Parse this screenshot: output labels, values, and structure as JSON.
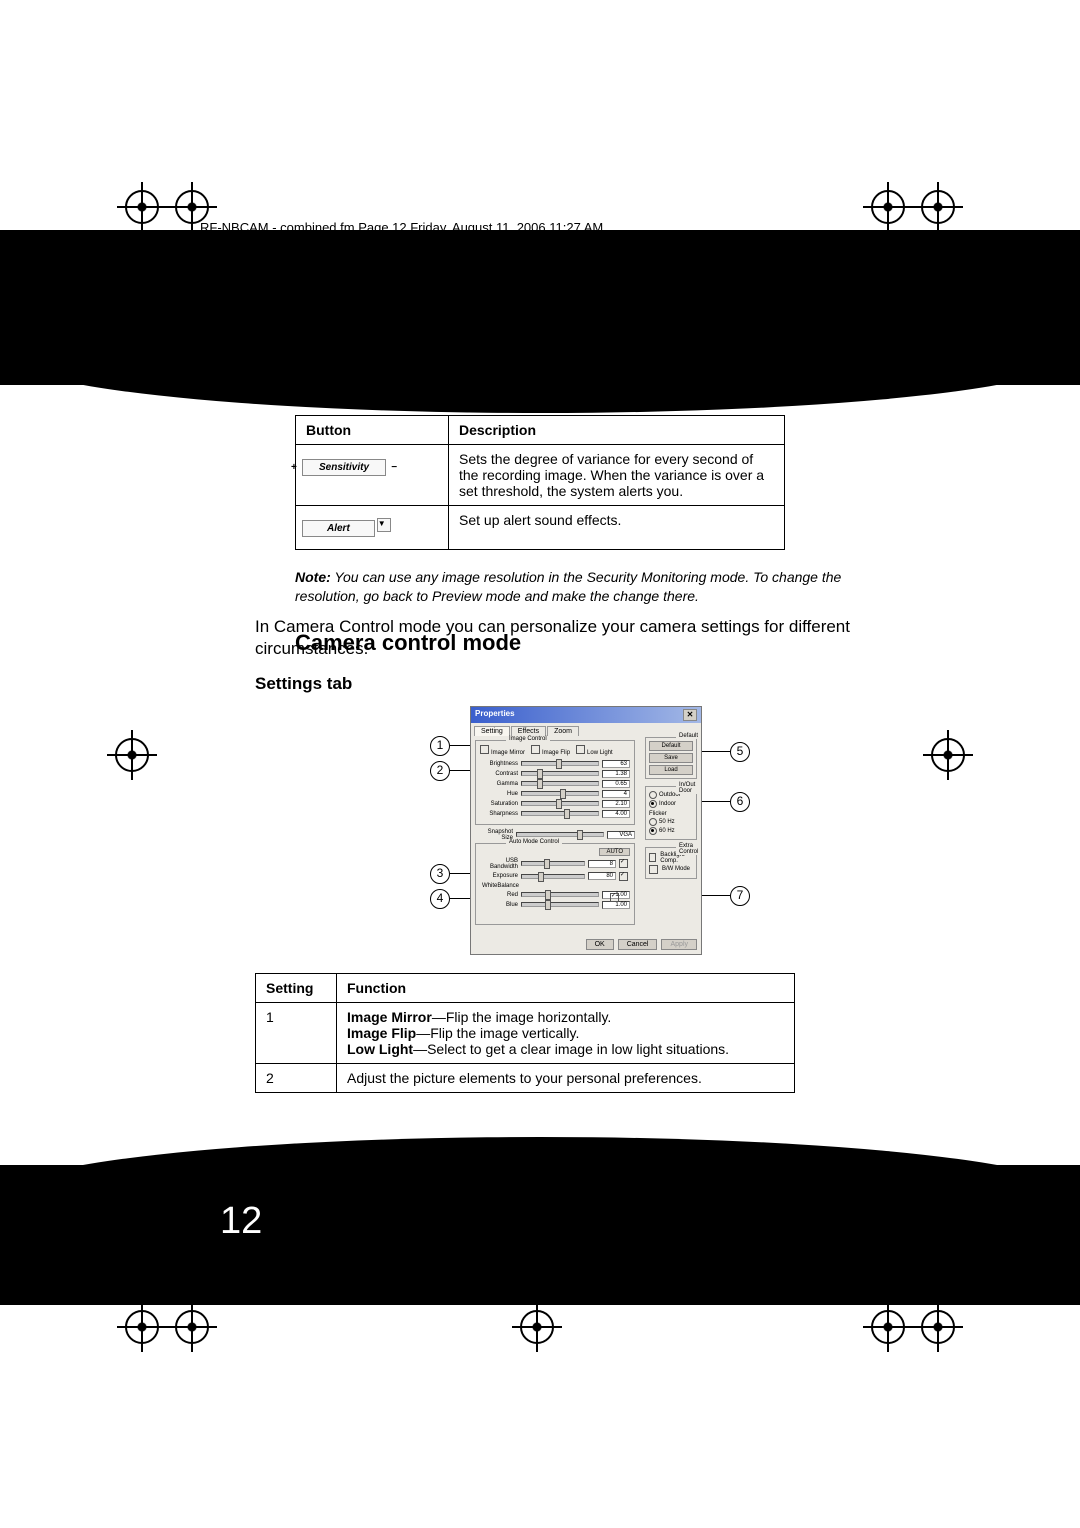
{
  "header": "RF-NBCAM - combined.fm  Page 12  Friday, August 11, 2006   11:27 AM",
  "page_number": "12",
  "table1": {
    "headers": [
      "Button",
      "Description"
    ],
    "rows": [
      {
        "btn": "Sensitivity",
        "desc": "Sets the degree of variance for every second of the recording image. When the variance is over a set threshold, the system alerts you."
      },
      {
        "btn": "Alert",
        "desc": "Set up alert sound effects."
      }
    ]
  },
  "note_label": "Note:",
  "note_text": " You can use any image resolution in the Security Monitoring mode. To change the resolution, go back to Preview mode and make the change there.",
  "section_heading": "Camera control mode",
  "section_body": "In Camera Control mode you can personalize your camera settings for different circumstances.",
  "subsection": "Settings tab",
  "dialog": {
    "title": "Properties",
    "tabs": [
      "Setting",
      "Effects",
      "Zoom"
    ],
    "image_control_legend": "Image Control",
    "checks": [
      "Image Mirror",
      "Image Flip",
      "Low Light"
    ],
    "sliders": [
      {
        "label": "Brightness",
        "val": "63",
        "pos": 45
      },
      {
        "label": "Contrast",
        "val": "1.38",
        "pos": 20
      },
      {
        "label": "Gamma",
        "val": "0.65",
        "pos": 20
      },
      {
        "label": "Hue",
        "val": "4",
        "pos": 50
      },
      {
        "label": "Saturation",
        "val": "2.10",
        "pos": 45
      },
      {
        "label": "Sharpness",
        "val": "4.00",
        "pos": 55
      }
    ],
    "snapshot_label": "Snapshot Size",
    "snapshot_val": "VGA",
    "auto_legend": "Auto Mode Control",
    "auto_btn": "AUTO",
    "auto_sliders": [
      {
        "label": "USB Bandwidth",
        "val": "8",
        "pos": 35
      },
      {
        "label": "Exposure",
        "val": "80",
        "pos": 25
      }
    ],
    "wb_label": "WhiteBalance",
    "wb_sliders": [
      {
        "label": "Red",
        "val": "1.00",
        "pos": 30
      },
      {
        "label": "Blue",
        "val": "1.00",
        "pos": 30
      }
    ],
    "default_legend": "Default",
    "default_btns": [
      "Default",
      "Save",
      "Load"
    ],
    "inout_legend": "In/Out Door",
    "inout_options": [
      "Outdoor",
      "Indoor"
    ],
    "flicker_label": "Flicker",
    "flicker_options": [
      "50 Hz",
      "60 Hz"
    ],
    "extra_legend": "Extra Control",
    "extra_checks": [
      "Backlight Comp.",
      "B/W Mode"
    ],
    "footer_btns": [
      "OK",
      "Cancel",
      "Apply"
    ]
  },
  "callouts": [
    "1",
    "2",
    "3",
    "4",
    "5",
    "6",
    "7"
  ],
  "table2": {
    "headers": [
      "Setting",
      "Function"
    ],
    "rows": [
      {
        "num": "1",
        "items": [
          {
            "b": "Image Mirror",
            "t": "—Flip the image horizontally."
          },
          {
            "b": "Image Flip",
            "t": "—Flip the image vertically."
          },
          {
            "b": "Low Light",
            "t": "—Select to get a clear image in low light situations."
          }
        ]
      },
      {
        "num": "2",
        "plain": "Adjust the picture elements to your personal preferences."
      }
    ]
  }
}
